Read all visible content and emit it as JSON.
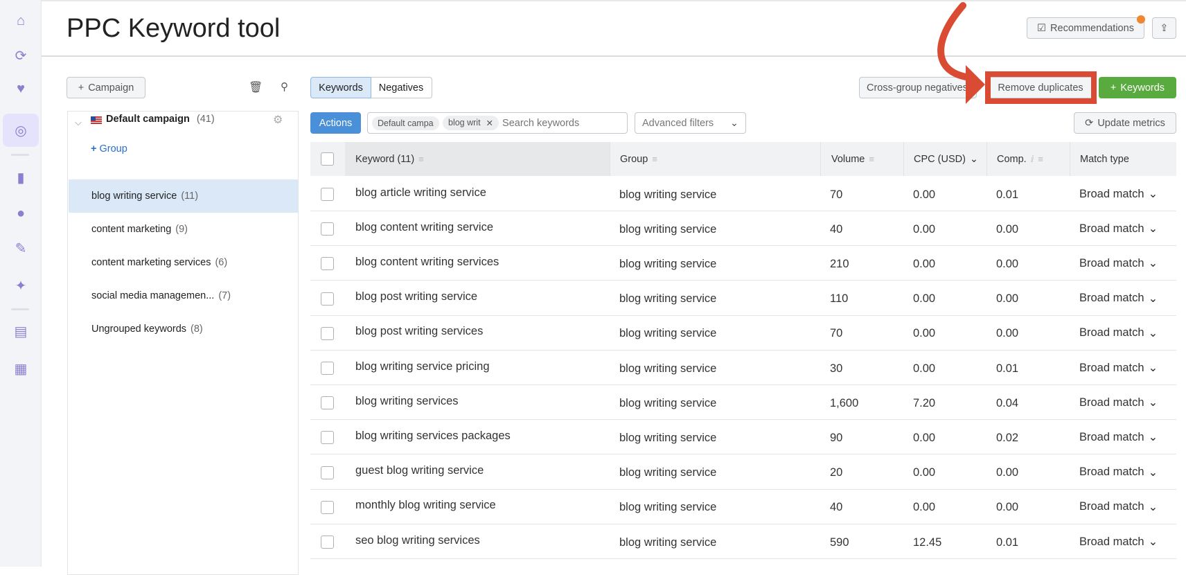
{
  "page": {
    "title": "PPC Keyword tool"
  },
  "sidebar": {
    "icons": [
      "home-icon",
      "search-icon",
      "heart-chat-icon",
      "cursor-target-icon",
      "bar-chart-icon",
      "location-pin-icon",
      "pencil-icon",
      "sparkle-trend-icon",
      "document-icon",
      "apps-icon"
    ]
  },
  "header": {
    "recommendations": "Recommendations",
    "export_icon": "export-icon"
  },
  "left": {
    "campaign_button": "Campaign",
    "campaign_name": "Default campaign",
    "campaign_count": "(41)",
    "add_group": "Group",
    "groups": [
      {
        "label": "blog writing service",
        "count": "(11)",
        "selected": true
      },
      {
        "label": "content marketing",
        "count": "(9)"
      },
      {
        "label": "content marketing services",
        "count": "(6)"
      },
      {
        "label": "social media managemen...",
        "count": "(7)"
      },
      {
        "label": "Ungrouped keywords",
        "count": "(8)"
      }
    ]
  },
  "toolbar": {
    "tab_keywords": "Keywords",
    "tab_negatives": "Negatives",
    "cross_group": "Cross-group negatives",
    "remove_duplicates": "Remove duplicates",
    "add_keywords": "Keywords",
    "actions": "Actions",
    "chip1": "Default campa",
    "chip2": "blog writ",
    "search_placeholder": "Search keywords",
    "advanced_filters": "Advanced filters",
    "update_metrics": "Update metrics"
  },
  "table": {
    "headers": {
      "keyword": "Keyword (11)",
      "group": "Group",
      "volume": "Volume",
      "cpc": "CPC (USD)",
      "comp": "Comp.",
      "match": "Match type"
    },
    "rows": [
      {
        "keyword": "blog article writing service",
        "group": "blog writing service",
        "volume": "70",
        "cpc": "0.00",
        "comp": "0.01",
        "match": "Broad match"
      },
      {
        "keyword": "blog content writing service",
        "group": "blog writing service",
        "volume": "40",
        "cpc": "0.00",
        "comp": "0.00",
        "match": "Broad match"
      },
      {
        "keyword": "blog content writing services",
        "group": "blog writing service",
        "volume": "210",
        "cpc": "0.00",
        "comp": "0.00",
        "match": "Broad match"
      },
      {
        "keyword": "blog post writing service",
        "group": "blog writing service",
        "volume": "110",
        "cpc": "0.00",
        "comp": "0.00",
        "match": "Broad match"
      },
      {
        "keyword": "blog post writing services",
        "group": "blog writing service",
        "volume": "70",
        "cpc": "0.00",
        "comp": "0.00",
        "match": "Broad match"
      },
      {
        "keyword": "blog writing service pricing",
        "group": "blog writing service",
        "volume": "30",
        "cpc": "0.00",
        "comp": "0.01",
        "match": "Broad match"
      },
      {
        "keyword": "blog writing services",
        "group": "blog writing service",
        "volume": "1,600",
        "cpc": "7.20",
        "comp": "0.04",
        "match": "Broad match"
      },
      {
        "keyword": "blog writing services packages",
        "group": "blog writing service",
        "volume": "90",
        "cpc": "0.00",
        "comp": "0.02",
        "match": "Broad match"
      },
      {
        "keyword": "guest blog writing service",
        "group": "blog writing service",
        "volume": "20",
        "cpc": "0.00",
        "comp": "0.00",
        "match": "Broad match"
      },
      {
        "keyword": "monthly blog writing service",
        "group": "blog writing service",
        "volume": "40",
        "cpc": "0.00",
        "comp": "0.00",
        "match": "Broad match"
      },
      {
        "keyword": "seo blog writing services",
        "group": "blog writing service",
        "volume": "590",
        "cpc": "12.45",
        "comp": "0.01",
        "match": "Broad match"
      }
    ]
  },
  "colors": {
    "accent_purple": "#8c7fd0",
    "primary_blue": "#4a90d9",
    "green": "#5aab3f",
    "annotation_red": "#d94c33",
    "selected_row": "#dbe8f7"
  }
}
